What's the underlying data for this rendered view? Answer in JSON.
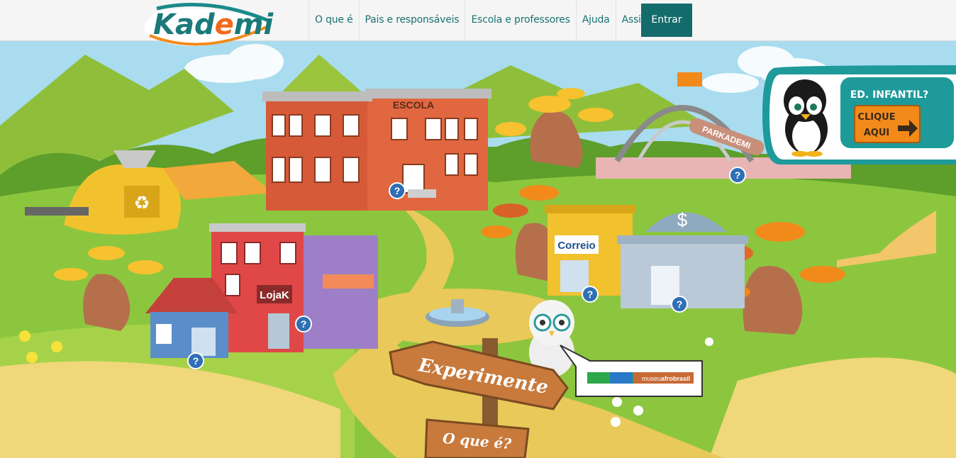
{
  "header": {
    "logo_text": "Kademi",
    "nav": [
      "O que é",
      "Pais e responsáveis",
      "Escola e professores",
      "Ajuda",
      "Assine"
    ],
    "enter_label": "Entrar"
  },
  "scene": {
    "school_sign": "ESCOLA",
    "store_sign": "LojaK",
    "post_sign": "Correio",
    "park_sign": "PARKADEMI",
    "bank_symbol": "$"
  },
  "infantil_promo": {
    "title": "ED. INFANTIL?",
    "button_line1": "CLIQUE",
    "button_line2": "AQUI"
  },
  "signpost": {
    "top": "Experimente",
    "bottom": "O que é?"
  },
  "partner": {
    "logo_text_a": "museu",
    "logo_text_b": "afrobrasil"
  },
  "colors": {
    "brand_teal": "#136b6b",
    "nav_text": "#1a7272",
    "grass": "#8cc63f",
    "path": "#e8c95a"
  }
}
